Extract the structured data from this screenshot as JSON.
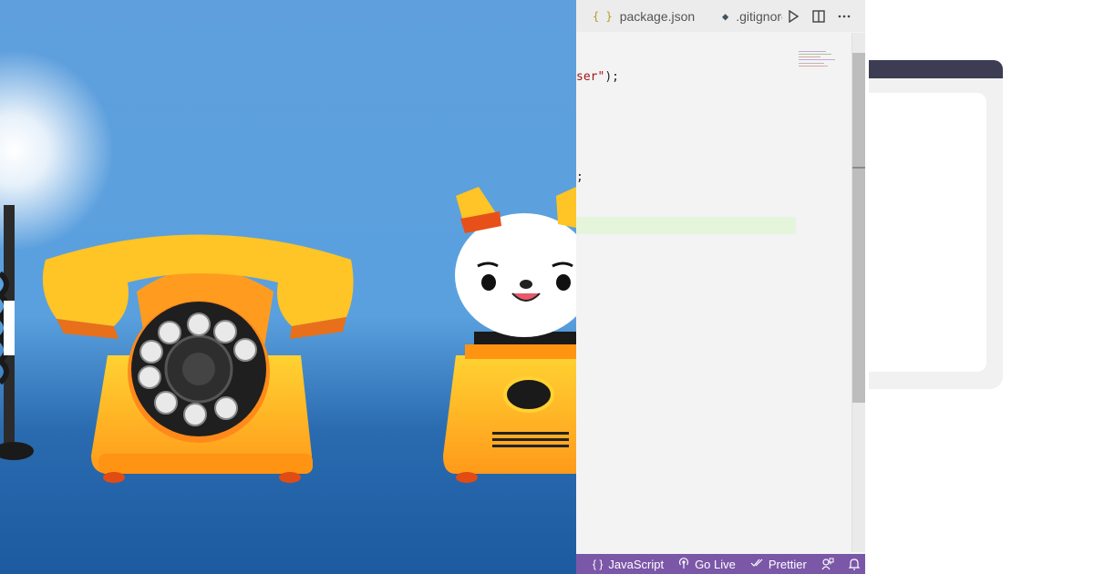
{
  "editor": {
    "tabs": [
      {
        "label": "package.json",
        "icon": "braces-icon"
      },
      {
        "label": ".gitignore",
        "icon": "git-icon"
      }
    ],
    "actions": [
      "run-icon",
      "split-editor-icon",
      "more-actions-icon"
    ],
    "code_lines": [
      {
        "text": "ser\");"
      },
      {
        "text": ";"
      }
    ],
    "status_bar": {
      "language": "JavaScript",
      "go_live": "Go Live",
      "prettier": "Prettier",
      "color": "#7b57a8"
    }
  },
  "colors": {
    "background_blue": "#5fa3dd",
    "phone_yellow": "#ffc425",
    "window_titlebar": "#3c3c52"
  }
}
